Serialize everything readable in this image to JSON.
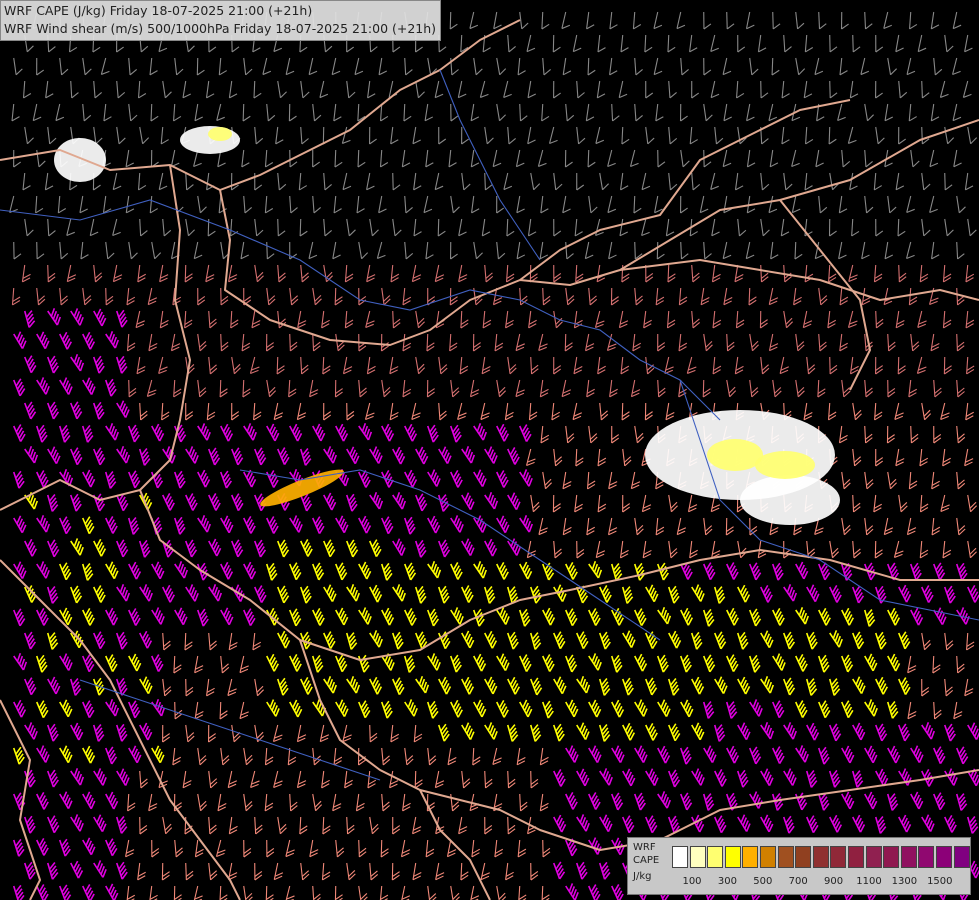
{
  "titles": {
    "line1": "WRF CAPE (J/kg) Friday 18-07-2025 21:00 (+21h)",
    "line2": "WRF Wind shear (m/s) 500/1000hPa Friday 18-07-2025 21:00 (+21h)"
  },
  "legend": {
    "label_lines": [
      "WRF",
      "CAPE",
      "J/kg"
    ],
    "swatch_colors": [
      "#ffffff",
      "#ffffc0",
      "#ffff70",
      "#ffff00",
      "#ffb000",
      "#d08000",
      "#a05020",
      "#904020",
      "#903030",
      "#902838",
      "#902040",
      "#902050",
      "#901850",
      "#901060",
      "#900870",
      "#8c0078",
      "#800080"
    ],
    "tick_labels": [
      "100",
      "300",
      "500",
      "700",
      "900",
      "1100",
      "1300",
      "1500"
    ]
  },
  "colors": {
    "shear_weak": "#888888",
    "shear_light": "#d47070",
    "shear_moderate": "#f08878",
    "shear_strong": "#ffff00",
    "shear_extreme": "#e000e0",
    "border": "#e0a890",
    "river": "#4060c0"
  }
}
